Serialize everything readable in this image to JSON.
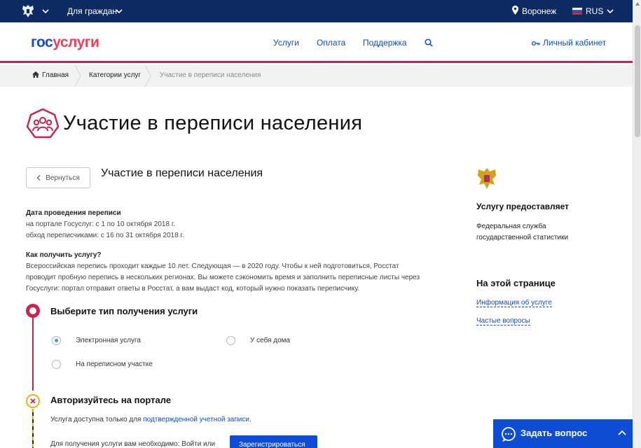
{
  "topbar": {
    "citizens_label": "Для граждан",
    "city": "Воронеж",
    "lang": "RUS"
  },
  "header": {
    "logo_gos": "гос",
    "logo_uslugi": "услуги",
    "nav": [
      "Услуги",
      "Оплата",
      "Поддержка"
    ],
    "cabinet": "Личный кабинет"
  },
  "breadcrumb": {
    "home": "Главная",
    "categories": "Категории услуг",
    "current": "Участие в переписи населения"
  },
  "page": {
    "title": "Участие в переписи населения",
    "back_label": "Вернуться",
    "subtitle": "Участие в переписи населения"
  },
  "info": {
    "dates_heading": "Дата проведения переписи",
    "dates_line1": "на портале Госуслуг: с 1 по 10 октября 2018 г.",
    "dates_line2": "обход переписчиками: с 16 по 31 октября 2018 г.",
    "how_heading": "Как получить услугу?",
    "how_line1": "Всероссийская перепись проходит каждые 10 лет. Следующая — в 2020 году. Чтобы к ней подготовиться, Росстат",
    "how_line2": "проводит пробную перепись в нескольких регионах. Вы можете сэкономить время и заполнить переписные листы через",
    "how_line3": "Госуслуги: портал отправит ответы в Росстат, а вам выдаст код, который нужно показать переписчику."
  },
  "step1": {
    "title": "Выберите тип получения услуги",
    "options": [
      "Электронная услуга",
      "У себя дома",
      "На переписном участке"
    ],
    "selected": "Электронная услуга"
  },
  "step2": {
    "title": "Авторизуйтесь на портале",
    "text_prefix": "Услуга доступна только для ",
    "text_link": "подтвержденной учетной записи",
    "text_suffix": ".",
    "text2": "Для получения услуги вам необходимо: Войти или",
    "register_label": "Зарегистрироваться"
  },
  "right": {
    "provider_heading": "Услугу предоставляет",
    "provider_line1": "Федеральная служба",
    "provider_line2": "государственной статистики",
    "on_page_heading": "На этой странице",
    "links": [
      "Информация об услуге",
      "Частые вопросы"
    ]
  },
  "chat": {
    "label": "Задать вопрос"
  },
  "colors": {
    "topbar": "#0d2b63",
    "brand_blue": "#0d4cd3",
    "brand_red": "#c8244b",
    "step_error": "#e8b21a"
  }
}
